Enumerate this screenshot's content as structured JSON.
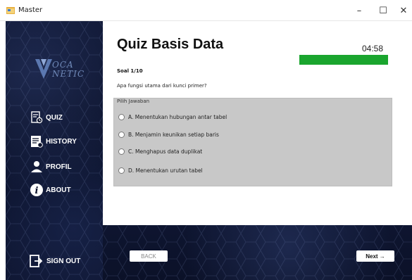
{
  "window": {
    "title": "Master",
    "minimize": "–",
    "maximize": "☐",
    "close": "✕"
  },
  "sidebar": {
    "logo": {
      "line1": "OCA",
      "line2": "NETIC"
    },
    "items": [
      {
        "label": "QUIZ",
        "icon": "quiz-icon"
      },
      {
        "label": "HISTORY",
        "icon": "history-icon"
      },
      {
        "label": "PROFIL",
        "icon": "profile-icon"
      },
      {
        "label": "ABOUT",
        "icon": "info-icon"
      }
    ],
    "signout": {
      "label": "SIGN OUT",
      "icon": "sign-out-icon"
    }
  },
  "quiz": {
    "title": "Quiz Basis Data",
    "timer": "04:58",
    "progress": 1.0,
    "progress_color": "#1aa52e",
    "counter": "Soal 1/10",
    "question": "Apa fungsi utama dari kunci primer?",
    "answers_legend": "Pilih Jawaban",
    "options": [
      "A. Menentukan hubungan antar tabel",
      "B. Menjamin keunikan setiap baris",
      "C. Menghapus data duplikat",
      "D. Menentukan urutan tabel"
    ]
  },
  "nav": {
    "back": "BACK",
    "next": "Next →"
  },
  "colors": {
    "sidebar": "#0e1530",
    "panel": "#c8c8c8",
    "accent": "#1aa52e"
  }
}
